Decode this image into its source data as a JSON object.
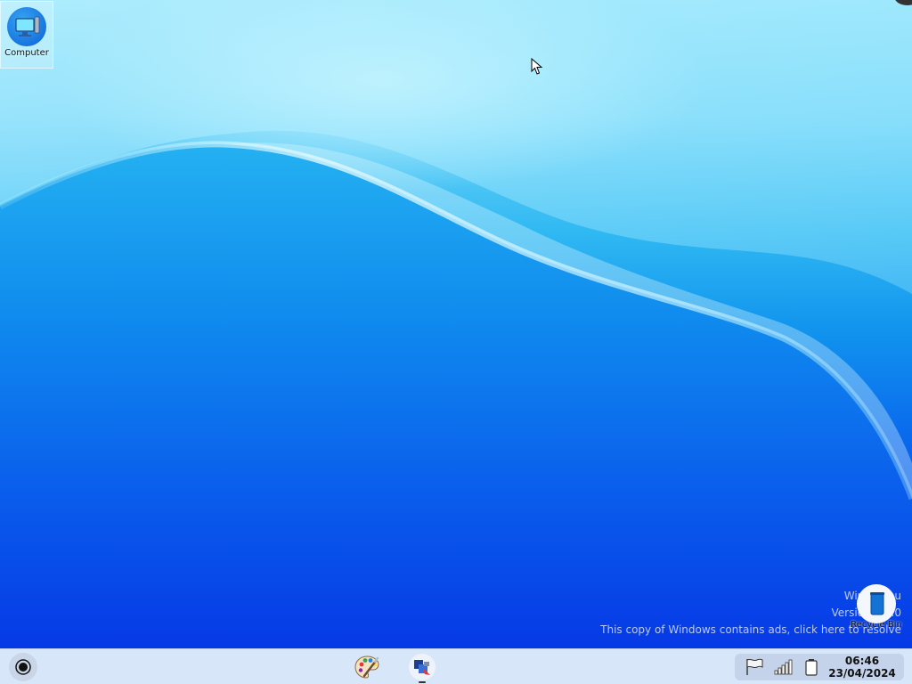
{
  "desktop": {
    "icons": {
      "computer": {
        "label": "Computer",
        "icon": "computer-monitor-icon"
      },
      "recycle_bin": {
        "label": "Recycle Bin",
        "icon": "recycle-bin-icon"
      }
    },
    "watermark": {
      "line1": "Win7 Simu",
      "line2": "Version 3.9.0",
      "line3": "This copy of Windows contains ads, click here to resolve"
    }
  },
  "taskbar": {
    "start": {
      "icon": "start-orb-icon"
    },
    "apps": [
      {
        "name": "paint",
        "icon": "paint-palette-icon"
      },
      {
        "name": "explorer",
        "icon": "explorer-icon",
        "active": true
      }
    ],
    "tray": {
      "icons": [
        "action-center-flag-icon",
        "signal-bars-icon",
        "battery-icon"
      ],
      "time": "06:46",
      "date": "23/04/2024"
    }
  },
  "colors": {
    "taskbar_bg": "#d7e6f8",
    "tray_bg": "#c4d3e9",
    "desktop_top": "#8fe3fb",
    "desktop_bottom": "#0639e6"
  }
}
